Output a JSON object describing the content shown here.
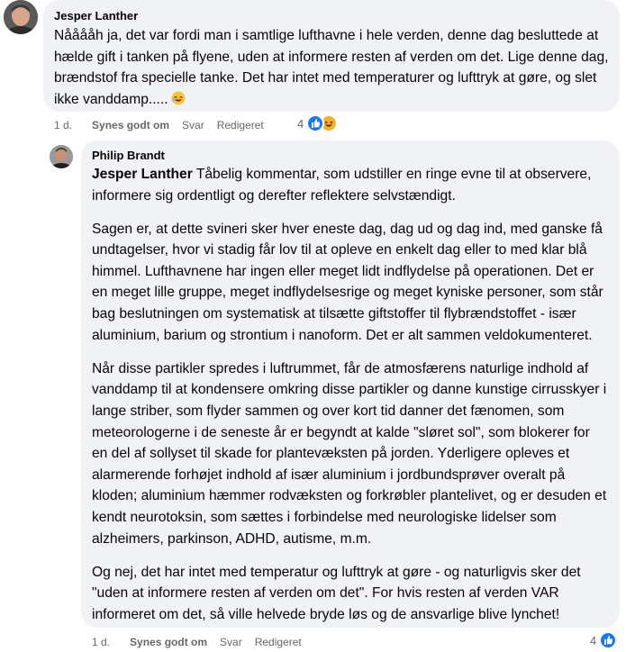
{
  "comment1": {
    "author": "Jesper Lanther",
    "text": "Nååååh ja, det var fordi man i samtlige lufthavne i hele verden, denne dag besluttede at hælde gift i tanken på flyene, uden at informere resten af verden om det. Lige denne dag, brændstof fra specielle tanke. Det har intet med temperaturer og lufttryk at gøre, og slet ikke vanddamp.....",
    "emoji": "rofl-emoji",
    "time": "1 d.",
    "like_label": "Synes godt om",
    "reply_label": "Svar",
    "edited_label": "Redigeret",
    "reaction_count": "4"
  },
  "comment2": {
    "author": "Philip Brandt",
    "mention": "Jesper Lanther",
    "paragraphs": [
      " Tåbelig kommentar, som udstiller en ringe evne til at observere, informere sig ordentligt og derefter reflektere selvstændigt.",
      "Sagen er, at dette svineri sker hver eneste dag, dag ud og dag ind, med ganske få undtagelser, hvor vi stadig får lov til at opleve en enkelt dag eller to med klar blå himmel. Lufthavnene har ingen eller meget lidt indflydelse på operationen. Det er en meget lille gruppe, meget indflydelsesrige og meget kyniske personer, som står bag beslutningen om systematisk at tilsætte giftstoffer til flybrændstoffet - især aluminium, barium og strontium i nanoform. Det er alt sammen veldokumenteret.",
      "Når disse partikler spredes i luftrummet, får de atmosfærens naturlige indhold af vanddamp til at kondensere omkring disse partikler og danne kunstige cirrusskyer i lange striber, som flyder sammen og over kort tid danner det fænomen, som meteorologerne i de seneste år er begyndt at kalde \"sløret sol\", som blokerer for en del af sollyset til skade for plantevæksten på jorden. Yderligere opleves et alarmerende forhøjet indhold af især aluminium i jordbundsprøver overalt på kloden; aluminium hæmmer rodvæksten og forkrøbler plantelivet, og er desuden et kendt neurotoksin, som sættes i forbindelse med neurologiske lidelser som alzheimers, parkinson, ADHD, autisme, m.m.",
      "Og nej, det har intet med temperatur og lufttryk at gøre - og naturligvis sker det \"uden at informere resten af verden om det\". For hvis resten af verden VAR informeret om det, så ville helvede bryde løs og de ansvarlige blive lynchet!"
    ],
    "time": "1 d.",
    "like_label": "Synes godt om",
    "reply_label": "Svar",
    "edited_label": "Redigeret",
    "reaction_count": "4"
  },
  "colors": {
    "bubble": "#f0f2f5",
    "meta_text": "#65676b",
    "like_blue": "#1877f2",
    "haha_yellow": "#f7b125"
  }
}
